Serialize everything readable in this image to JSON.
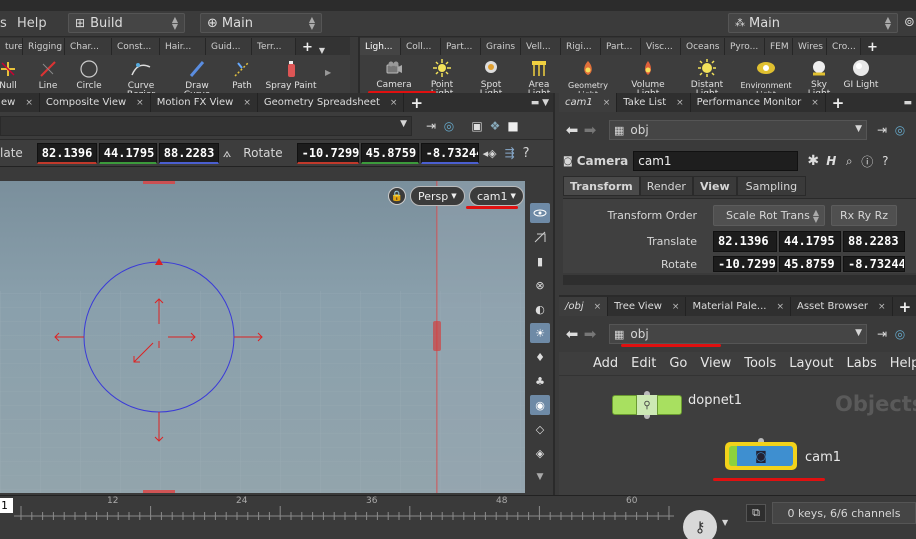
{
  "menubar": {
    "help_label": "Help",
    "desktop_label": "Build",
    "viewport_workspace": "Main",
    "right_workspace": "Main",
    "left_cut_text": "s"
  },
  "shelf_left": {
    "tabs": [
      "ture",
      "Rigging",
      "Char...",
      "Const...",
      "Hair...",
      "Guid...",
      "Terr..."
    ],
    "tools": [
      "Null",
      "Line",
      "Circle",
      "Curve Bezier",
      "Draw Curve",
      "Path",
      "Spray Paint"
    ]
  },
  "shelf_right": {
    "tabs": [
      "Ligh...",
      "Coll...",
      "Part...",
      "Grains",
      "Vell...",
      "Rigi...",
      "Part...",
      "Visc...",
      "Oceans",
      "Pyro...",
      "FEM",
      "Wires",
      "Cro..."
    ],
    "tools": [
      "Camera",
      "Point Light",
      "Spot Light",
      "Area Light",
      "Geometry Light",
      "Volume Light",
      "Distant Light",
      "Environment Light",
      "Sky Light",
      "GI Light"
    ]
  },
  "viewer": {
    "tabs": [
      "ew",
      "Composite View",
      "Motion FX View",
      "Geometry Spreadsheet"
    ],
    "translate_label": "late",
    "translate": [
      "82.1396",
      "44.1795",
      "88.2283"
    ],
    "rotate_label": "Rotate",
    "rotate": [
      "-10.7299",
      "45.8759",
      "-8.73244"
    ],
    "persp_label": "Persp",
    "cam_label": "cam1"
  },
  "params": {
    "tabs": [
      "cam1",
      "Take List",
      "Performance Monitor"
    ],
    "path": "obj",
    "node_type": "Camera",
    "node_name": "cam1",
    "sub_tabs": [
      "Transform",
      "Render",
      "View",
      "Sampling"
    ],
    "transform_order_label": "Transform Order",
    "transform_order_value": "Scale Rot Trans",
    "rot_order_value": "Rx Ry Rz",
    "translate_label": "Translate",
    "translate": [
      "82.1396",
      "44.1795",
      "88.2283"
    ],
    "rotate_label": "Rotate",
    "rotate": [
      "-10.7299",
      "45.8759",
      "-8.73244"
    ]
  },
  "network": {
    "tabs": [
      "/obj",
      "Tree View",
      "Material Pale...",
      "Asset Browser"
    ],
    "path": "obj",
    "menu": [
      "Add",
      "Edit",
      "Go",
      "View",
      "Tools",
      "Layout",
      "Labs",
      "Help"
    ],
    "watermark": "Objects",
    "nodes": [
      {
        "name": "dopnet1"
      },
      {
        "name": "cam1"
      }
    ]
  },
  "timeline": {
    "frame": "1",
    "ticks": [
      "12",
      "24",
      "36",
      "48",
      "60"
    ],
    "keys_status": "0 keys, 6/6 channels"
  },
  "colors": {
    "accent_red": "#e01010",
    "node_green": "#8cd23c",
    "node_blue": "#3e8fd0",
    "selected_yellow": "#f2d21a"
  }
}
